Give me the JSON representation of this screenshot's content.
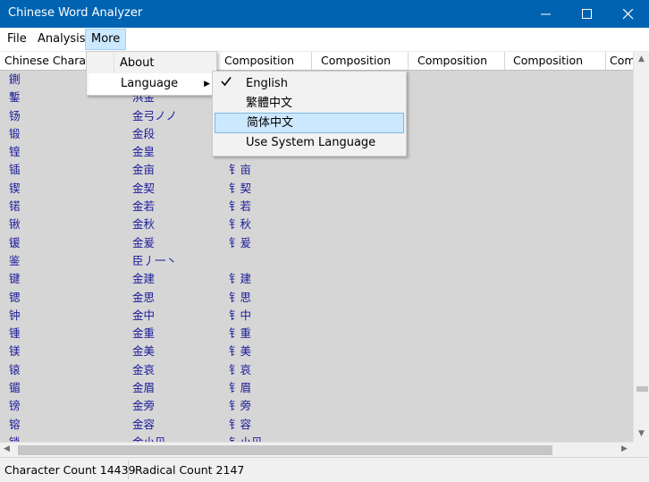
{
  "window": {
    "title": "Chinese Word Analyzer"
  },
  "menubar": {
    "items": [
      "File",
      "Analysis",
      "More"
    ]
  },
  "table": {
    "columns": [
      "Chinese Character",
      "",
      "Composition",
      "Composition",
      "Composition",
      "Composition",
      "Composition"
    ],
    "rows": [
      [
        "鍘",
        "",
        ""
      ],
      [
        "鏨",
        "浜金",
        ""
      ],
      [
        "钖",
        "金弓ノノ",
        ""
      ],
      [
        "锻",
        "金段",
        ""
      ],
      [
        "锽",
        "金皇",
        ""
      ],
      [
        "锸",
        "金亩",
        "钅亩"
      ],
      [
        "锲",
        "金契",
        "钅契"
      ],
      [
        "锘",
        "金若",
        "钅若"
      ],
      [
        "锹",
        "金秋",
        "钅秋"
      ],
      [
        "锾",
        "金爰",
        "钅爰"
      ],
      [
        "鉴",
        "臣丿一丶",
        ""
      ],
      [
        "键",
        "金建",
        "钅建"
      ],
      [
        "锶",
        "金思",
        "钅思"
      ],
      [
        "钟",
        "金中",
        "钅中"
      ],
      [
        "锺",
        "金重",
        "钅重"
      ],
      [
        "镁",
        "金美",
        "钅美"
      ],
      [
        "锿",
        "金哀",
        "钅哀"
      ],
      [
        "镅",
        "金眉",
        "钅眉"
      ],
      [
        "镑",
        "金旁",
        "钅旁"
      ],
      [
        "镕",
        "金容",
        "钅容"
      ],
      [
        "锁",
        "金小贝",
        "钅小贝"
      ]
    ]
  },
  "more_menu": {
    "items": [
      "About",
      "Language"
    ]
  },
  "language_menu": {
    "items": [
      "English",
      "繁體中文",
      "简体中文",
      "Use System Language"
    ],
    "checked": "English",
    "highlighted": "简体中文"
  },
  "status": {
    "character_count": "Character Count 14439",
    "radical_count": "Radical Count 2147"
  },
  "colors": {
    "titlebar": "#0063b1",
    "highlight": "#cce8ff"
  }
}
